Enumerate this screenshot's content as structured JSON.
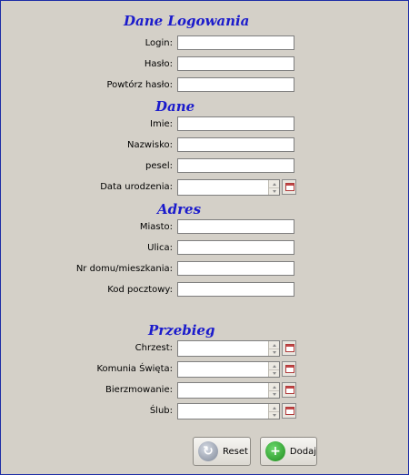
{
  "sections": {
    "login": "Dane Logowania",
    "personal": "Dane",
    "address": "Adres",
    "history": "Przebieg"
  },
  "fields": {
    "login": {
      "label": "Login:",
      "value": ""
    },
    "password": {
      "label": "Hasło:",
      "value": ""
    },
    "repeat_password": {
      "label": "Powtórz hasło:",
      "value": ""
    },
    "first_name": {
      "label": "Imie:",
      "value": ""
    },
    "last_name": {
      "label": "Nazwisko:",
      "value": ""
    },
    "pesel": {
      "label": "pesel:",
      "value": ""
    },
    "birth_date": {
      "label": "Data urodzenia:",
      "value": ""
    },
    "city": {
      "label": "Miasto:",
      "value": ""
    },
    "street": {
      "label": "Ulica:",
      "value": ""
    },
    "house_number": {
      "label": "Nr domu/mieszkania:",
      "value": ""
    },
    "postal_code": {
      "label": "Kod pocztowy:",
      "value": ""
    },
    "baptism": {
      "label": "Chrzest:",
      "value": ""
    },
    "communion": {
      "label": "Komunia Święta:",
      "value": ""
    },
    "confirmation": {
      "label": "Bierzmowanie:",
      "value": ""
    },
    "wedding": {
      "label": "Ślub:",
      "value": ""
    }
  },
  "buttons": {
    "reset": "Reset",
    "add": "Dodaj"
  },
  "icons": {
    "reset": "refresh-icon",
    "add": "plus-icon",
    "calendar": "calendar-icon"
  }
}
